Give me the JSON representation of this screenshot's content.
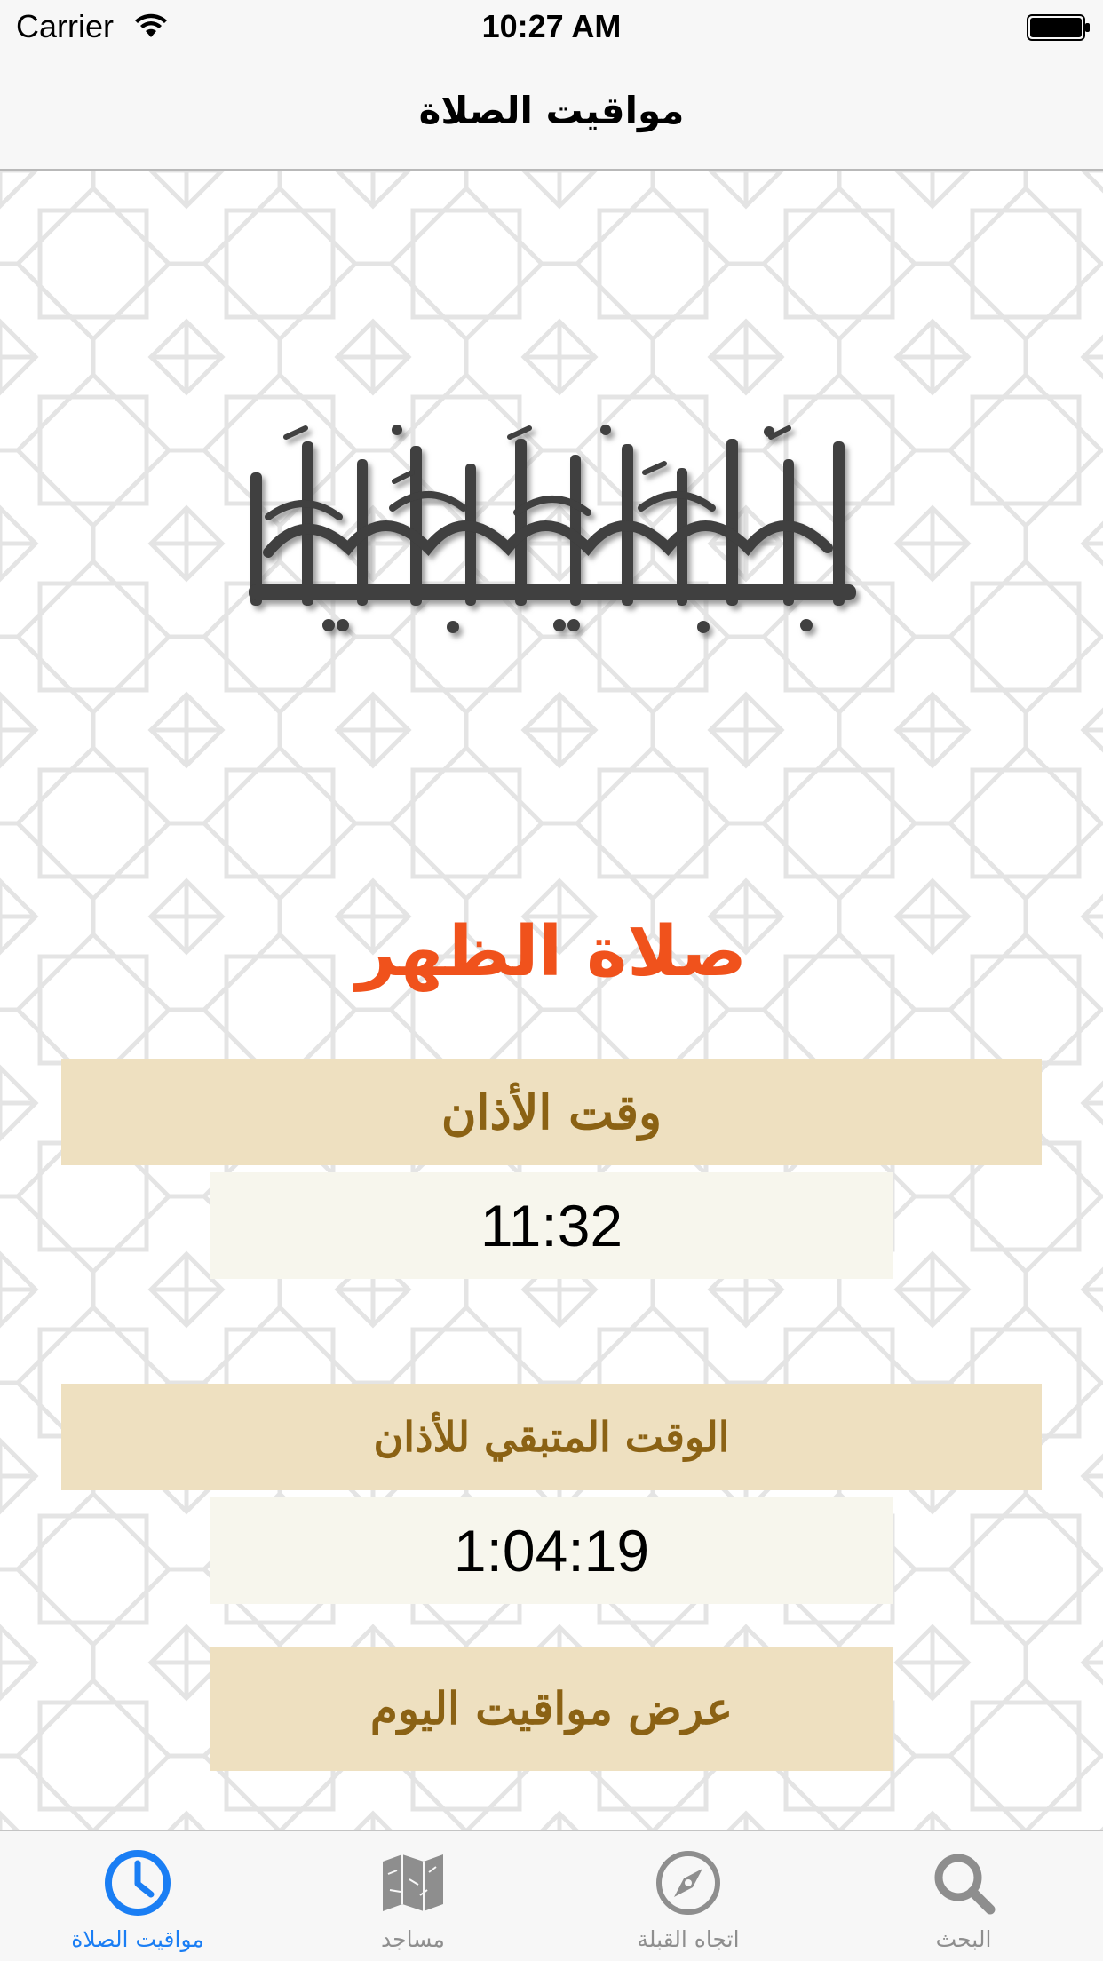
{
  "status_bar": {
    "carrier": "Carrier",
    "time": "10:27 AM",
    "wifi_icon": "wifi-icon",
    "battery_icon": "battery-full-icon"
  },
  "nav": {
    "title": "مواقيت الصلاة"
  },
  "banner": {
    "text": "إن الصلوة كانت على المؤمنين كتابا موقوتا",
    "signature": "عثماني"
  },
  "prayer": {
    "name": "صلاة الظهر",
    "adhan_label": "وقت الأذان",
    "adhan_time": "11:32",
    "remaining_label": "الوقت المتبقي للأذان",
    "remaining_time": "1:04:19",
    "show_today_label": "عرض مواقيت اليوم"
  },
  "tabs": [
    {
      "label": "مواقيت الصلاة",
      "icon": "clock-icon",
      "active": true
    },
    {
      "label": "مساجد",
      "icon": "map-icon",
      "active": false
    },
    {
      "label": "اتجاه القبلة",
      "icon": "compass-icon",
      "active": false
    },
    {
      "label": "البحث",
      "icon": "search-icon",
      "active": false
    }
  ],
  "colors": {
    "accent": "#1a7ef4",
    "prayer_title": "#f0521c",
    "label_background": "#eee0c0",
    "label_text": "#8b6214",
    "value_background": "#f7f6ed",
    "tab_inactive": "#8e8e8e"
  }
}
